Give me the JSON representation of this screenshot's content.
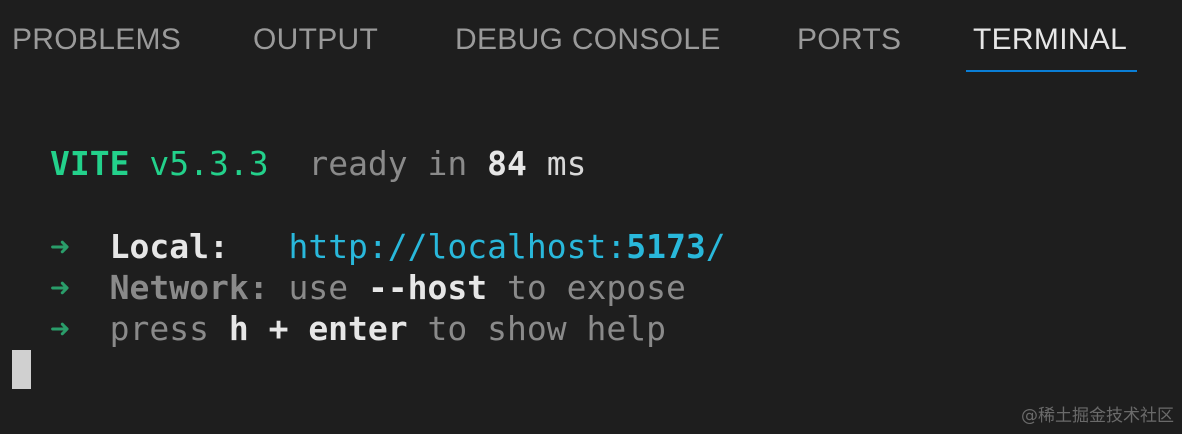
{
  "tabs": [
    {
      "label": "PROBLEMS",
      "active": false
    },
    {
      "label": "OUTPUT",
      "active": false
    },
    {
      "label": "DEBUG CONSOLE",
      "active": false
    },
    {
      "label": "PORTS",
      "active": false
    },
    {
      "label": "TERMINAL",
      "active": true
    }
  ],
  "terminal": {
    "header": {
      "brand": "VITE",
      "version": "v5.3.3",
      "ready_text": "ready in",
      "time_value": "84",
      "time_unit": "ms"
    },
    "arrow": "➜",
    "local": {
      "label": "Local:",
      "url_prefix": "http://localhost:",
      "port": "5173",
      "url_suffix": "/"
    },
    "network": {
      "label": "Network:",
      "text1": "use",
      "flag": "--host",
      "text2": "to expose"
    },
    "help": {
      "text1": "press",
      "key": "h + enter",
      "text2": "to show help"
    }
  },
  "watermark": "@稀土掘金技术社区",
  "colors": {
    "background": "#1e1e1e",
    "active_tab_underline": "#0a7ed6",
    "vite_green": "#23d18b",
    "link_cyan": "#29b8db"
  }
}
